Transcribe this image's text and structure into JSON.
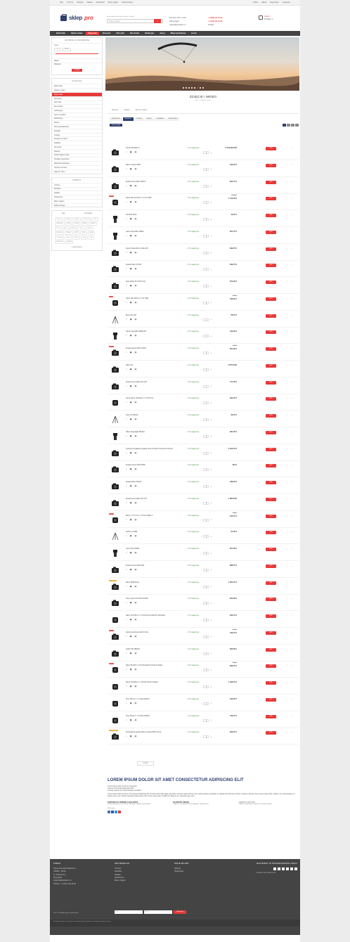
{
  "topbar": {
    "left": [
      "Start",
      "O Firmie",
      "Dostawa",
      "Zapłata",
      "Aktualności",
      "Baner zdjęcie",
      "Dokumentacja"
    ],
    "right": [
      "Polska",
      "Waluta",
      "Rejestracja",
      "Logowanie"
    ]
  },
  "header": {
    "logo_a": "sklep",
    "logo_b": "pro",
    "hint": "Na przykład:  Bestseller,  Nowości,  Rabat",
    "search_placeholder": "Drogi produkty",
    "search_btn": "⌕",
    "hours": "Pon-Sob: 9:00 - 21:00",
    "call": "call me back",
    "email": "support@websiteru.ru",
    "phone1": "+7 (999) 111-22-33",
    "phone2": "+7 (912) 111-22-33",
    "info": "Kontakt",
    "cart": "Koszyk",
    "cart_count": "Produkty: 0"
  },
  "nav": [
    "Elektronika",
    "Odzież i wideo",
    "Wyprzedaż",
    "Akcesoria",
    "Stół rynku",
    "Bez dostaw",
    "Edukacyjne",
    "więcej",
    "Sklep łączalnikowe",
    "Hostel"
  ],
  "sidebar": {
    "filter_title": "SZYBKIE FILTROWANIE",
    "price": "Cena",
    "p_from": "0",
    "p_to": "4670",
    "f1": "Marka",
    "f2": "Wielkość",
    "apply": "POKAŻ",
    "cat_title": "KATALOG",
    "cats": [
      "Elektronika",
      "Zdjęcie i wideo",
      "Wyprzedaż",
      "Akcesoria",
      "Stół rynku",
      "Bez dostaw",
      "edukacyjne",
      "Sport na odzież",
      "Edukacyjne",
      "Wiosło",
      "Strony łączalnikowe",
      "Zabawki",
      "Ozdoby",
      "Drogeria na dzieci",
      "Zabawki",
      "Akcesoria",
      "Budowy",
      "Sztuki zdjęcia moda",
      "Produkty ogrodnicze",
      "Materiały budowlane",
      "Artykuły do domu",
      "Zdjęcia z filmu"
    ],
    "pages_title": "STRONY",
    "pages": [
      "O firmie",
      "Dostawa",
      "Zapłata",
      "Aktualności",
      "Baner zdjęcie",
      "Dokumentacja"
    ],
    "tags_title": "Tagi",
    "tags_sub": "Wszystkie",
    "tags": [
      "kamera",
      "modele",
      "aparaty",
      "lustrzanki",
      "tanie",
      "obiektywy",
      "Sony",
      "Canon",
      "Nikon",
      "ostrość",
      "Film",
      "zoom",
      "GoPro",
      "makro",
      "statyw",
      "pluszowy",
      "Kinowe",
      "MM",
      "Tesla",
      "wideo",
      "Samsung",
      "sport",
      "zestaw",
      "lampy",
      "filtr",
      "akcesoria",
      "outdoor"
    ],
    "tags_more": "POKAŻ WIĘCEJ"
  },
  "main": {
    "title": "ZDJĘCIE I WIDEO",
    "breadcrumb": "Start  >  Zdjęcie i wideo",
    "tabs": [
      "Domowe",
      "Zapłata",
      "Jak nas znaleźć"
    ],
    "filters": [
      "KATEGORIE",
      "Wszystkie",
      "ZDJĘCIE",
      "WIDEO",
      "GRZEBIEŃ",
      "AKCESORIA"
    ],
    "sort": "Sortuj według",
    "in_stock": "W magazynie",
    "buy": "KUP",
    "more": "POKAŻ",
    "products": [
      {
        "name": "Canon 5D Mark III",
        "price": "3 512,58 EUR",
        "old": "",
        "badge": ""
      },
      {
        "name": "Nikon Coolpix P520",
        "price": "342,25 €",
        "old": "",
        "badge": ""
      },
      {
        "name": "Zestaw Sony Alpha NEX-5",
        "price": "831,75 €",
        "old": "",
        "badge": ""
      },
      {
        "name": "Canon EF 24-70mm f / 4L IS USM",
        "price": "1 110,00 €",
        "old": "1 269,00",
        "badge": "-13%"
      },
      {
        "name": "DJI DLR S612",
        "price": "13,75 €",
        "old": "",
        "badge": ""
      },
      {
        "name": "Canon Speedlite 320EX",
        "price": "207,75 €",
        "old": "",
        "badge": ""
      },
      {
        "name": "Canon PowerShot G-Sole M3",
        "price": "399,75 €",
        "old": "",
        "badge": ""
      },
      {
        "name": "Zestaw Nikon D7100",
        "price": "399,75 €",
        "old": "",
        "badge": ""
      },
      {
        "name": "Sony Alpha SLT-A57 body",
        "price": "454,50 €",
        "old": "",
        "badge": ""
      },
      {
        "name": "Canon EF 100mm f / 2.8 USM",
        "price": "736,25 €",
        "old": "750,00",
        "badge": "-2%"
      },
      {
        "name": "Benro KF-218",
        "price": "58,75 €",
        "old": "",
        "badge": ""
      },
      {
        "name": "Canon Speedlite 600EX-RT",
        "price": "443,50 €",
        "old": "",
        "badge": ""
      },
      {
        "name": "Zestaw Canon EOS 1100D",
        "price": "354,50 €",
        "old": "445,00",
        "badge": "-20%"
      },
      {
        "name": "Nikon D4",
        "price": "4 975 EUR",
        "old": "",
        "badge": ""
      },
      {
        "name": "Zestaw Sony Alpha SLT-A57",
        "price": "717,50 €",
        "old": "",
        "badge": ""
      },
      {
        "name": "Canon EF-S 18-200mm f / 3.5-5.6 IS",
        "price": "394,25 €",
        "old": "",
        "badge": ""
      },
      {
        "name": "Sony VCT-R640",
        "price": "49,75 €",
        "old": "",
        "badge": ""
      },
      {
        "name": "Nikon Speedlight SB-910",
        "price": "387,25 €",
        "old": "",
        "badge": ""
      },
      {
        "name": "Cyfrowy kompaktowy aparat Leica X2 Silver Premium Premium",
        "price": "2 310,75 €",
        "old": "",
        "badge": ""
      },
      {
        "name": "Zestaw Canon EOS 600D",
        "price": "481 €",
        "old": "",
        "badge": ""
      },
      {
        "name": "Zestaw Nikon D3100",
        "price": "496,25 €",
        "old": "",
        "badge": ""
      },
      {
        "name": "Zestaw Sony Alpha SLT-A77",
        "price": "1 180 EUR",
        "old": "",
        "badge": ""
      },
      {
        "name": "Nikon 1 17-5 mm f / 3.5-5.6 Nikkor 1",
        "price": "123,75 €",
        "old": "155,00",
        "badge": "-20%"
      },
      {
        "name": "Velbon CX-888",
        "price": "37,25 €",
        "old": "",
        "badge": ""
      },
      {
        "name": "Sony HVL-F43AM",
        "price": "257,50 €",
        "old": "",
        "badge": ""
      },
      {
        "name": "Zestaw Canon EOS 60D",
        "price": "898,75 €",
        "old": "",
        "badge": ""
      },
      {
        "name": "Nikon D800 Body",
        "price": "1 624,75 €",
        "old": "",
        "badge": "NOWOŚĆ"
      },
      {
        "name": "Sony Cyber-shot DSC-HX200",
        "price": "324,50 €",
        "old": "",
        "badge": ""
      },
      {
        "name": "Nikon 18-105mm f / 3.5-5.6G AF-S ED DX VR Nikkor",
        "price": "233,75 €",
        "old": "",
        "badge": ""
      },
      {
        "name": "Kamera sportowa GoPro Hero",
        "price": "449,75 €",
        "old": "470,75",
        "badge": "-13%"
      },
      {
        "name": "GoPro HD HERO2",
        "price": "369,50 €",
        "old": "",
        "badge": ""
      },
      {
        "name": "Nikon 55-300 f / 4.5-5.6G ED DX VR AF-S Nikkor",
        "price": "369,75 €",
        "old": "399,00",
        "badge": "-10%"
      },
      {
        "name": "Nikon 28-300mm f / 4G ED VR AF-S Nikkor",
        "price": "1 198,75 €",
        "old": "",
        "badge": ""
      },
      {
        "name": "Sony 50mm f / 1.4 (SAL-50F14)",
        "price": "342,25 €",
        "old": "",
        "badge": ""
      },
      {
        "name": "Sony 50mm f / 1.8 (SAL-50F18)",
        "price": "149,75 €",
        "old": "",
        "badge": ""
      },
      {
        "name": "Kompaktowy aparat Nikon Coolpix P520 czarny",
        "price": "299,75 €",
        "old": "",
        "badge": "POLECANE"
      }
    ]
  },
  "seo": {
    "title": "LOREM IPSUM DOLOR SIT AMET CONSECTETUR ADIPISCING ELIT",
    "b1": "Lorem ipsum dolor sit amet consectetur",
    "b2": "Aenean Commodo ligula eget dolor.",
    "b3": "Aenean massa cum sociis natoque penatibus",
    "p": "Lorem ipsum dolor sit amet, consectetuer adipiscing elit. Aenean Commodo ligula eget dolor. Aenean massa strong. Cum sociis natoque penatibus et magnis dis parturient montes, nascetur ridiculus mus. Donec quam felis, ultricies nec, pellentesque eu, pretium quis, sem. Nulla consequat massa quis enim. Donec pede justo, fringilla vel, aliquet nec, vulputate eget, arcu.",
    "f1t": "DOSTAWA NA TERENIE CAŁEJ ROSJI",
    "f1": "Dostarczamy towar na terenie całej Rosji, szybko i niezawodnie.",
    "f2t": "PŁATNOŚĆ ONLINE",
    "f2": "Zapłać za zamówienie kartą wygodnie i bezpiecznie.",
    "f3t": "ODBIÓR W SKLEPIE",
    "f3": "Odbierz zamówienie osobiście w naszym sklepie.",
    "share": "Udostępnij"
  },
  "footer": {
    "c1t": "FIRMA",
    "c1": [
      "Tamat autorstwa Websitu.ru",
      "190000 , Rosja",
      "St. Petersburg ,",
      "Wuyuanka",
      "support@websiteru.ru",
      "Telefon: +7 (921) 123-45-67"
    ],
    "c2t": "INFORMACJA",
    "c2": [
      "O firmie",
      "Dostawa",
      "Zapłata",
      "Aktualności",
      "Baner zdjęcie"
    ],
    "c3t": "MOJE BIURO",
    "c3": [
      "Wejście",
      "Rejestracja"
    ],
    "c4t": "JESTEŚMY W SPOŁECZNOŚCI SIECI",
    "c4": "POWIEDZ PRZYJACIOŁOM",
    "copy": "2017 © Wszelkie prawa zastrzeżone",
    "sub_ph": "Imię",
    "sub_ph2": "Email",
    "sub_btn": "Subskrybuj",
    "note": "Informacje zawarte w serwisie nie stanowią oferty handlowej w rozumieniu przepisów prawa."
  }
}
